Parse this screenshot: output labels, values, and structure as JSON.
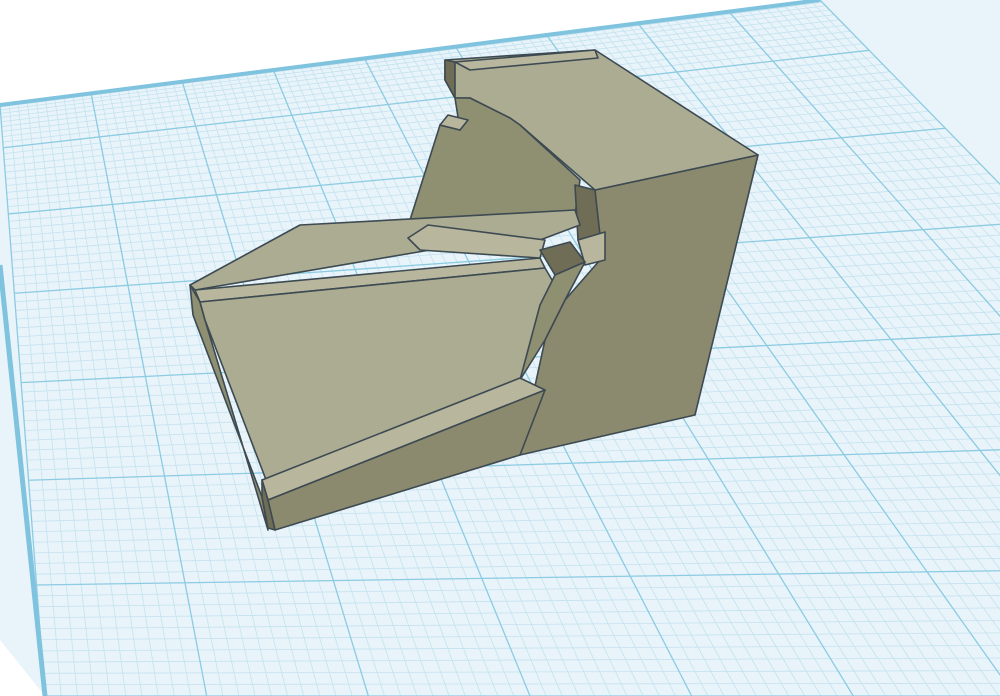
{
  "scene": {
    "background_color": "#ffffff",
    "workplane_fill": "#e8f4fa",
    "grid_minor_color": "#c4e2ef",
    "grid_major_color": "#8ccbe2",
    "workplane_edge_color": "#7fc3de",
    "model_colors": {
      "top_face": "#acac92",
      "front_face": "#8b8a6e",
      "ramp_face": "#acac92",
      "side_face": "#8f8f71",
      "ledge_face": "#b8b79d",
      "dark_face": "#6f6d55",
      "edge_line": "#3d4a52"
    }
  }
}
